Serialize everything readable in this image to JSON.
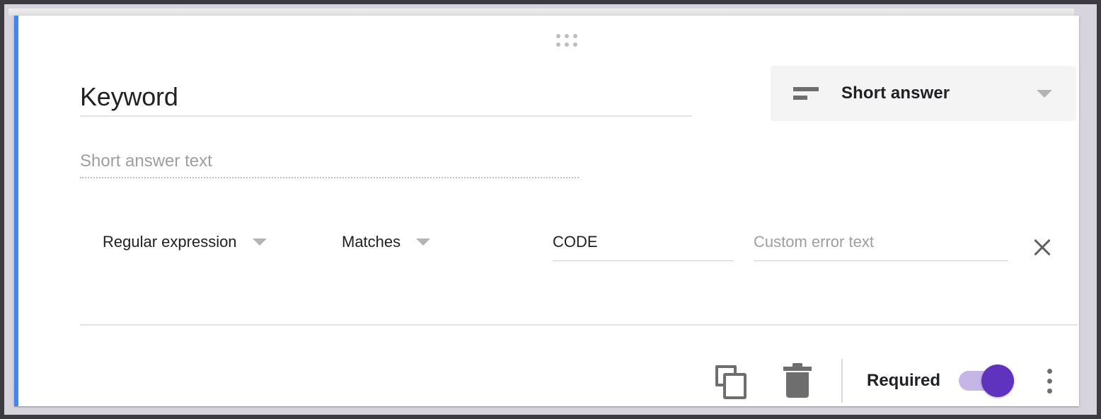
{
  "card": {
    "accent_color": "#4285f4",
    "drag_handle_icon": "drag-handle-dots-icon"
  },
  "question": {
    "title": "Keyword",
    "answer_placeholder": "Short answer text",
    "type_selector": {
      "label": "Short answer",
      "icon": "short-answer-icon",
      "chevron": "chevron-down-icon"
    }
  },
  "validation": {
    "rule": "Regular expression",
    "condition": "Matches",
    "pattern_value": "CODE",
    "error_placeholder": "Custom error text",
    "remove_icon": "close-icon"
  },
  "footer": {
    "duplicate_icon": "duplicate-icon",
    "delete_icon": "trash-icon",
    "required_label": "Required",
    "required_on": true,
    "toggle_track_color": "#c6b6e8",
    "toggle_knob_color": "#5f33bd",
    "more_icon": "more-vert-icon"
  }
}
